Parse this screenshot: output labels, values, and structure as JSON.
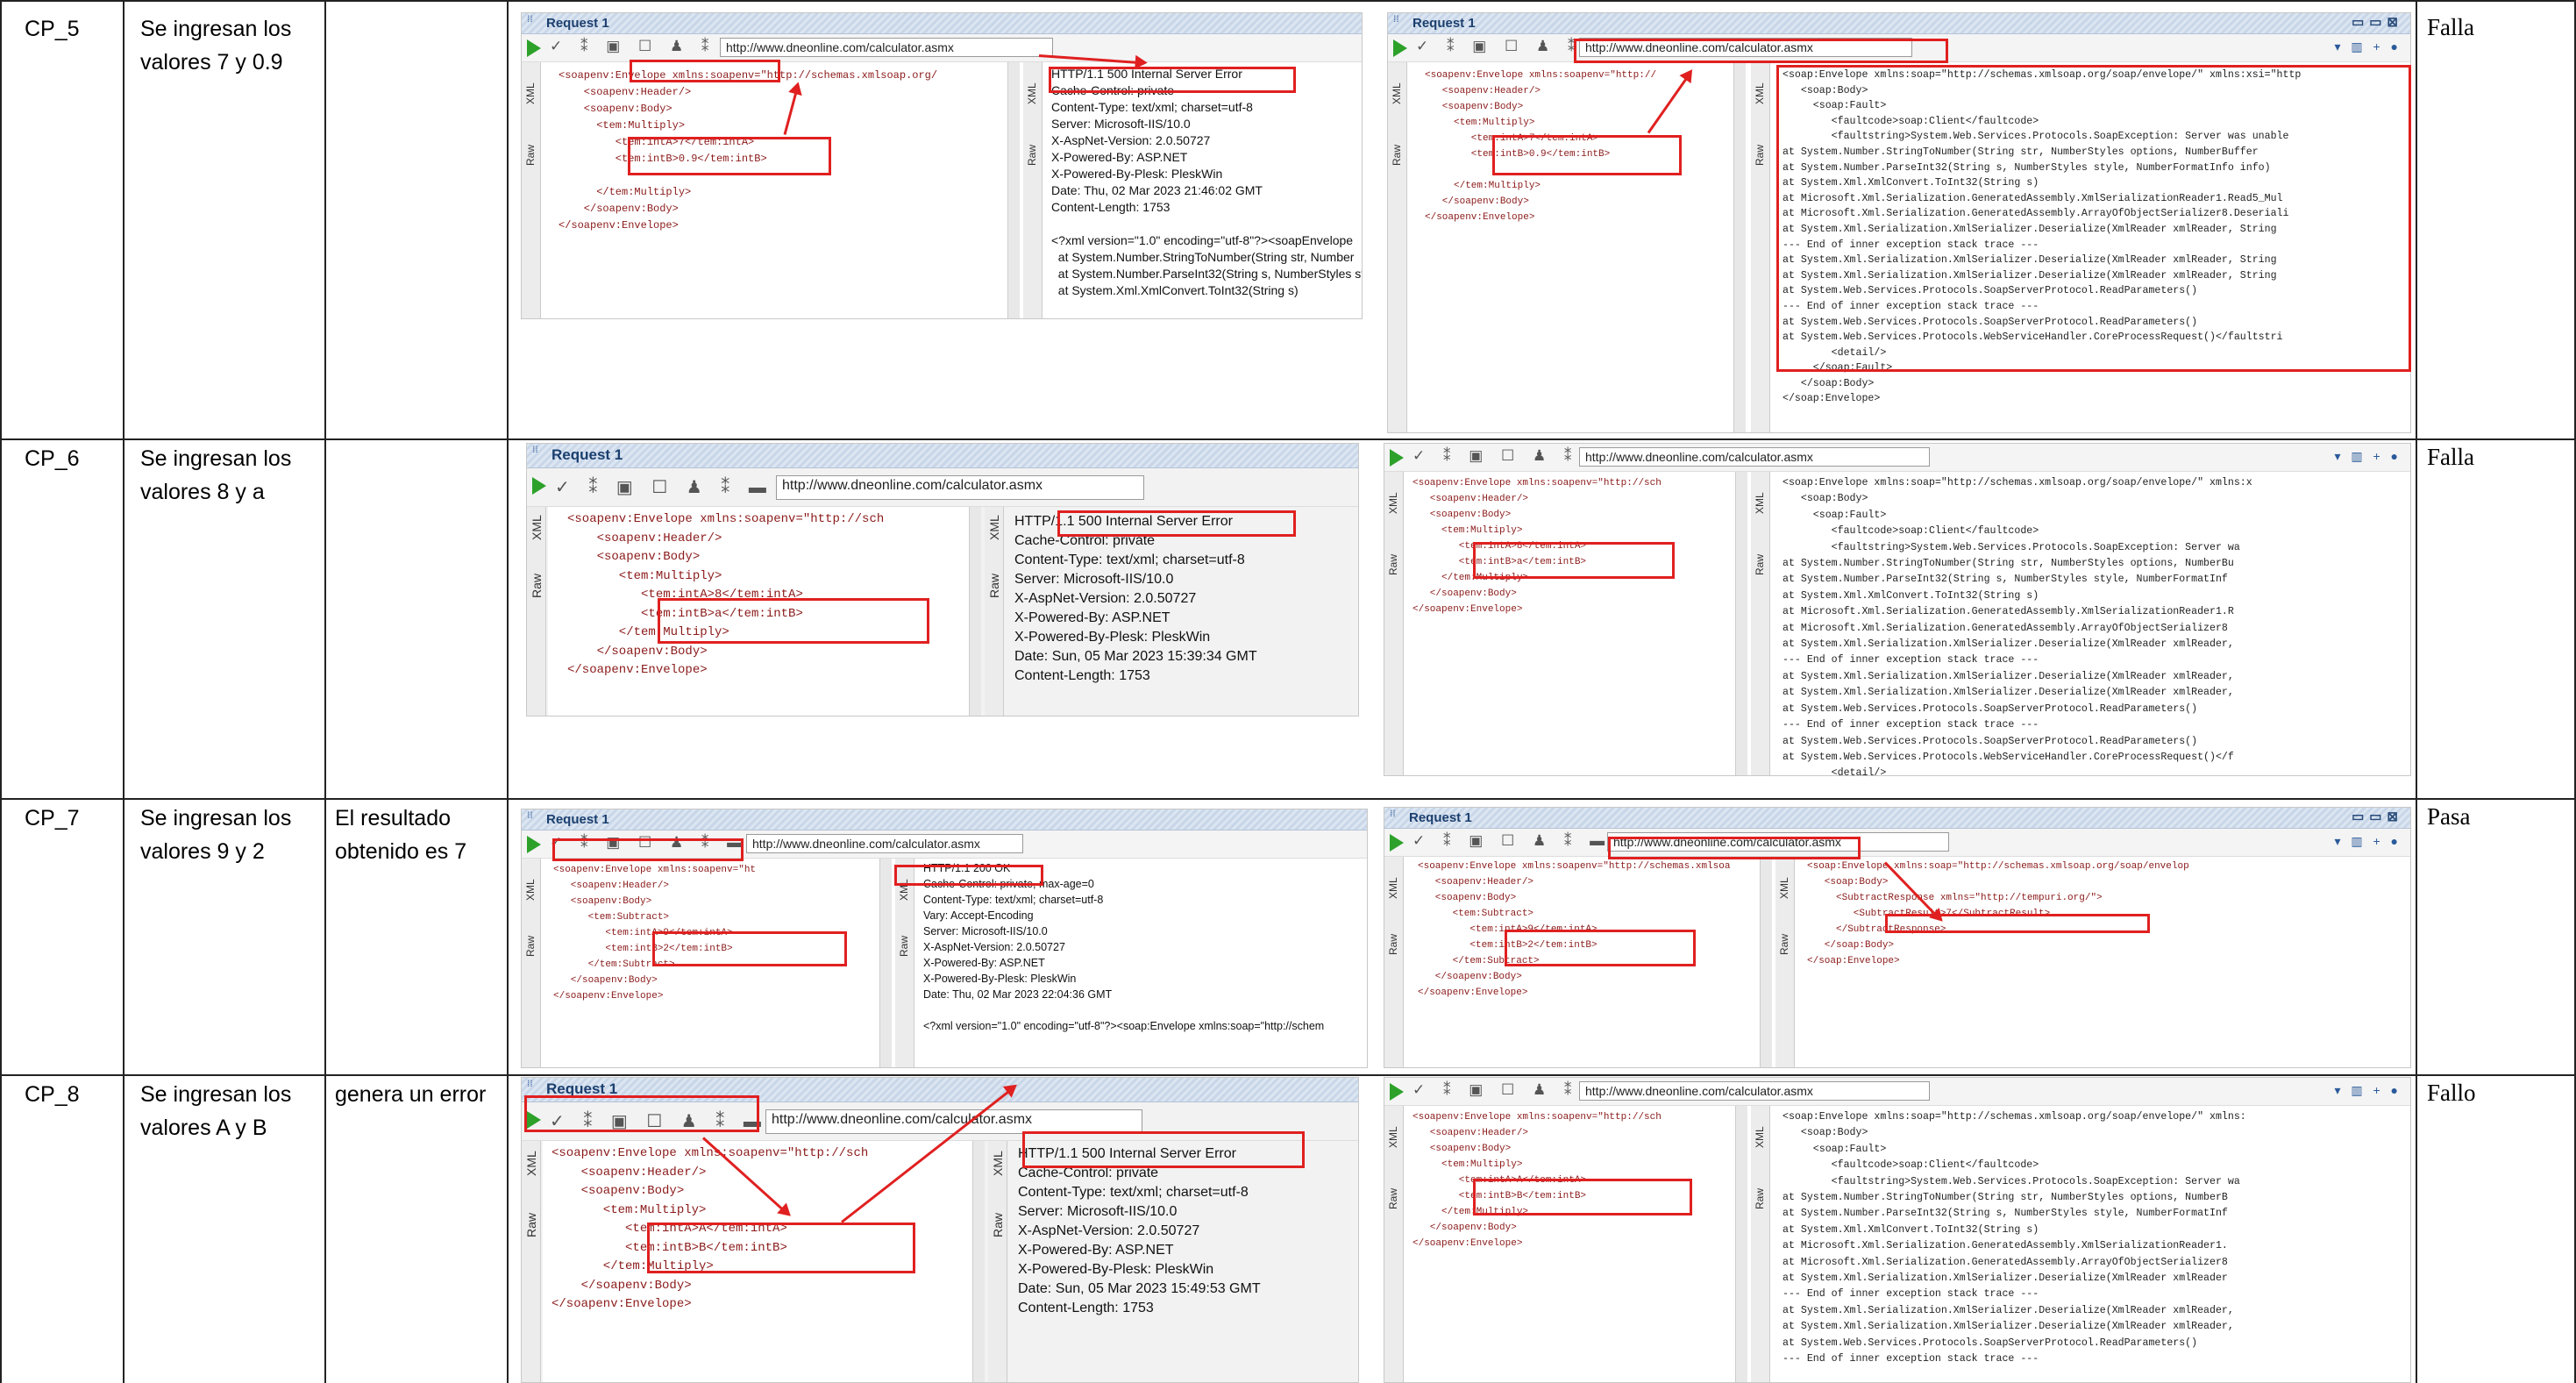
{
  "rows": [
    {
      "id": "CP_5",
      "description": "Se ingresan los valores 7 y 0.9",
      "expected": "",
      "result": "Falla",
      "request_left": {
        "title": "Request 1",
        "url": "http://www.dneonline.com/calculator.asmx",
        "xml": "<soapenv:Envelope xmlns:soapenv=\"http://schemas.xmlsoap.org/\n    <soapenv:Header/>\n    <soapenv:Body>\n      <tem:Multiply>\n         <tem:intA>7</tem:intA>\n         <tem:intB>0.9</tem:intB>\n\n      </tem:Multiply>\n    </soapenv:Body>\n</soapenv:Envelope>",
        "response": "HTTP/1.1 500 Internal Server Error\nCache-Control: private\nContent-Type: text/xml; charset=utf-8\nServer: Microsoft-IIS/10.0\nX-AspNet-Version: 2.0.50727\nX-Powered-By: ASP.NET\nX-Powered-By-Plesk: PleskWin\nDate: Thu, 02 Mar 2023 21:46:02 GMT\nContent-Length: 1753\n\n<?xml version=\"1.0\" encoding=\"utf-8\"?><soapEnvelope\n  at System.Number.StringToNumber(String str, Number\n  at System.Number.ParseInt32(String s, NumberStyles st\n  at System.Xml.XmlConvert.ToInt32(String s)"
      },
      "request_right": {
        "title": "Request 1",
        "url": "http://www.dneonline.com/calculator.asmx",
        "xml": "<soapenv:Envelope xmlns:soapenv=\"http://\n   <soapenv:Header/>\n   <soapenv:Body>\n     <tem:Multiply>\n        <tem:intA>7</tem:intA>\n        <tem:intB>0.9</tem:intB>\n\n     </tem:Multiply>\n   </soapenv:Body>\n</soapenv:Envelope>",
        "response": "<soap:Envelope xmlns:soap=\"http://schemas.xmlsoap.org/soap/envelope/\" xmlns:xsi=\"http\n   <soap:Body>\n     <soap:Fault>\n        <faultcode>soap:Client</faultcode>\n        <faultstring>System.Web.Services.Protocols.SoapException: Server was unable\nat System.Number.StringToNumber(String str, NumberStyles options, NumberBuffer\nat System.Number.ParseInt32(String s, NumberStyles style, NumberFormatInfo info)\nat System.Xml.XmlConvert.ToInt32(String s)\nat Microsoft.Xml.Serialization.GeneratedAssembly.XmlSerializationReader1.Read5_Mul\nat Microsoft.Xml.Serialization.GeneratedAssembly.ArrayOfObjectSerializer8.Deseriali\nat System.Xml.Serialization.XmlSerializer.Deserialize(XmlReader xmlReader, String\n--- End of inner exception stack trace ---\nat System.Xml.Serialization.XmlSerializer.Deserialize(XmlReader xmlReader, String\nat System.Xml.Serialization.XmlSerializer.Deserialize(XmlReader xmlReader, String\nat System.Web.Services.Protocols.SoapServerProtocol.ReadParameters()\n--- End of inner exception stack trace ---\nat System.Web.Services.Protocols.SoapServerProtocol.ReadParameters()\nat System.Web.Services.Protocols.WebServiceHandler.CoreProcessRequest()</faultstri\n        <detail/>\n     </soap:Fault>\n   </soap:Body>\n</soap:Envelope>"
      }
    },
    {
      "id": "CP_6",
      "description": "Se ingresan los valores 8 y a",
      "expected": "",
      "result": "Falla",
      "request_left": {
        "title": "Request 1",
        "url": "http://www.dneonline.com/calculator.asmx",
        "xml": "<soapenv:Envelope xmlns:soapenv=\"http://sch\n    <soapenv:Header/>\n    <soapenv:Body>\n       <tem:Multiply>\n          <tem:intA>8</tem:intA>\n          <tem:intB>a</tem:intB>\n       </tem:Multiply>\n    </soapenv:Body>\n</soapenv:Envelope>",
        "response": "HTTP/1.1 500 Internal Server Error\nCache-Control: private\nContent-Type: text/xml; charset=utf-8\nServer: Microsoft-IIS/10.0\nX-AspNet-Version: 2.0.50727\nX-Powered-By: ASP.NET\nX-Powered-By-Plesk: PleskWin\nDate: Sun, 05 Mar 2023 15:39:34 GMT\nContent-Length: 1753"
      },
      "request_right": {
        "title": "",
        "url": "http://www.dneonline.com/calculator.asmx",
        "xml": "<soapenv:Envelope xmlns:soapenv=\"http://sch\n   <soapenv:Header/>\n   <soapenv:Body>\n     <tem:Multiply>\n        <tem:intA>8</tem:intA>\n        <tem:intB>a</tem:intB>\n     </tem:Multiply>\n   </soapenv:Body>\n</soapenv:Envelope>",
        "response": "<soap:Envelope xmlns:soap=\"http://schemas.xmlsoap.org/soap/envelope/\" xmlns:x\n   <soap:Body>\n     <soap:Fault>\n        <faultcode>soap:Client</faultcode>\n        <faultstring>System.Web.Services.Protocols.SoapException: Server wa\nat System.Number.StringToNumber(String str, NumberStyles options, NumberBu\nat System.Number.ParseInt32(String s, NumberStyles style, NumberFormatInf\nat System.Xml.XmlConvert.ToInt32(String s)\nat Microsoft.Xml.Serialization.GeneratedAssembly.XmlSerializationReader1.R\nat Microsoft.Xml.Serialization.GeneratedAssembly.ArrayOfObjectSerializer8\nat System.Xml.Serialization.XmlSerializer.Deserialize(XmlReader xmlReader,\n--- End of inner exception stack trace ---\nat System.Xml.Serialization.XmlSerializer.Deserialize(XmlReader xmlReader,\nat System.Xml.Serialization.XmlSerializer.Deserialize(XmlReader xmlReader,\nat System.Web.Services.Protocols.SoapServerProtocol.ReadParameters()\n--- End of inner exception stack trace ---\nat System.Web.Services.Protocols.SoapServerProtocol.ReadParameters()\nat System.Web.Services.Protocols.WebServiceHandler.CoreProcessRequest()</f\n        <detail/>"
      }
    },
    {
      "id": "CP_7",
      "description": "Se ingresan los valores 9 y 2",
      "expected": "El resultado obtenido es 7",
      "result": "Pasa",
      "request_left": {
        "title": "Request 1",
        "url": "http://www.dneonline.com/calculator.asmx",
        "xml": "<soapenv:Envelope xmlns:soapenv=\"ht\n   <soapenv:Header/>\n   <soapenv:Body>\n      <tem:Subtract>\n         <tem:intA>9</tem:intA>\n         <tem:intB>2</tem:intB>\n      </tem:Subtract>\n   </soapenv:Body>\n</soapenv:Envelope>",
        "response": "HTTP/1.1 200 OK\nCache-Control: private, max-age=0\nContent-Type: text/xml; charset=utf-8\nVary: Accept-Encoding\nServer: Microsoft-IIS/10.0\nX-AspNet-Version: 2.0.50727\nX-Powered-By: ASP.NET\nX-Powered-By-Plesk: PleskWin\nDate: Thu, 02 Mar 2023 22:04:36 GMT\n\n<?xml version=\"1.0\" encoding=\"utf-8\"?><soap:Envelope xmlns:soap=\"http://schem"
      },
      "request_right": {
        "title": "Request 1",
        "url": "http://www.dneonline.com/calculator.asmx",
        "xml": "<soapenv:Envelope xmlns:soapenv=\"http://schemas.xmlsoa\n   <soapenv:Header/>\n   <soapenv:Body>\n      <tem:Subtract>\n         <tem:intA>9</tem:intA>\n         <tem:intB>2</tem:intB>\n      </tem:Subtract>\n   </soapenv:Body>\n</soapenv:Envelope>",
        "response": "<soap:Envelope xmlns:soap=\"http://schemas.xmlsoap.org/soap/envelop\n   <soap:Body>\n     <SubtractResponse xmlns=\"http://tempuri.org/\">\n        <SubtractResult>7</SubtractResult>\n     </SubtractResponse>\n   </soap:Body>\n</soap:Envelope>"
      }
    },
    {
      "id": "CP_8",
      "description": "Se ingresan los valores A y B",
      "expected": "genera un error",
      "result": "Fallo",
      "request_left": {
        "title": "Request 1",
        "url": "http://www.dneonline.com/calculator.asmx",
        "xml": "<soapenv:Envelope xmlns:soapenv=\"http://sch\n    <soapenv:Header/>\n    <soapenv:Body>\n       <tem:Multiply>\n          <tem:intA>A</tem:intA>\n          <tem:intB>B</tem:intB>\n       </tem:Multiply>\n    </soapenv:Body>\n</soapenv:Envelope>",
        "response": "HTTP/1.1 500 Internal Server Error\nCache-Control: private\nContent-Type: text/xml; charset=utf-8\nServer: Microsoft-IIS/10.0\nX-AspNet-Version: 2.0.50727\nX-Powered-By: ASP.NET\nX-Powered-By-Plesk: PleskWin\nDate: Sun, 05 Mar 2023 15:49:53 GMT\nContent-Length: 1753"
      },
      "request_right": {
        "title": "",
        "url": "http://www.dneonline.com/calculator.asmx",
        "xml": "<soapenv:Envelope xmlns:soapenv=\"http://sch\n   <soapenv:Header/>\n   <soapenv:Body>\n     <tem:Multiply>\n        <tem:intA>A</tem:intA>\n        <tem:intB>B</tem:intB>\n     </tem:Multiply>\n   </soapenv:Body>\n</soapenv:Envelope>",
        "response": "<soap:Envelope xmlns:soap=\"http://schemas.xmlsoap.org/soap/envelope/\" xmlns:\n   <soap:Body>\n     <soap:Fault>\n        <faultcode>soap:Client</faultcode>\n        <faultstring>System.Web.Services.Protocols.SoapException: Server wa\nat System.Number.StringToNumber(String str, NumberStyles options, NumberB\nat System.Number.ParseInt32(String s, NumberStyles style, NumberFormatInf\nat System.Xml.XmlConvert.ToInt32(String s)\nat Microsoft.Xml.Serialization.GeneratedAssembly.XmlSerializationReader1.\nat Microsoft.Xml.Serialization.GeneratedAssembly.ArrayOfObjectSerializer8\nat System.Xml.Serialization.XmlSerializer.Deserialize(XmlReader xmlReader\n--- End of inner exception stack trace ---\nat System.Xml.Serialization.XmlSerializer.Deserialize(XmlReader xmlReader,\nat System.Xml.Serialization.XmlSerializer.Deserialize(XmlReader xmlReader,\nat System.Web.Services.Protocols.SoapServerProtocol.ReadParameters()\n--- End of inner exception stack trace ---"
      }
    }
  ],
  "ui": {
    "tab_xml": "XML",
    "tab_raw": "Raw"
  },
  "colors": {
    "highlight": "#e02020",
    "play": "#2da12a"
  }
}
